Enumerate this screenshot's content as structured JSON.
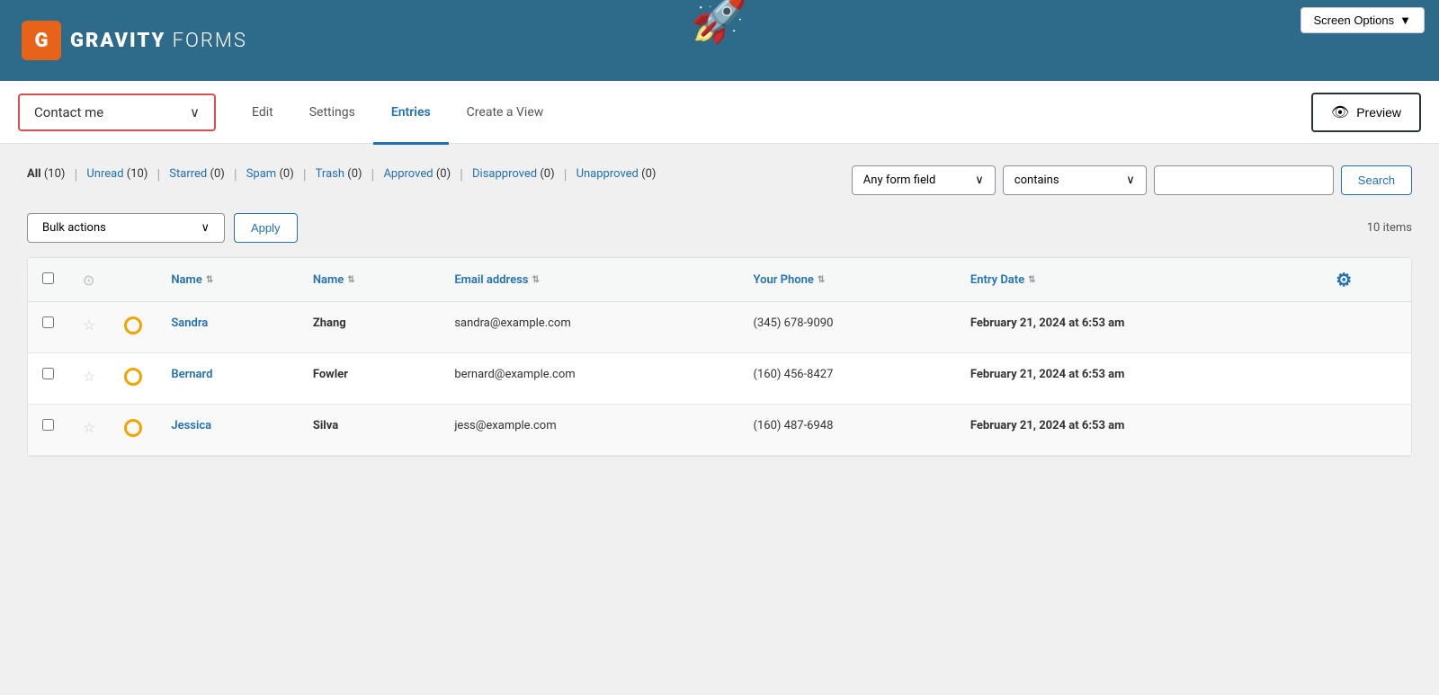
{
  "header": {
    "logo_letter": "G",
    "logo_bold": "GRAVITY",
    "logo_light": " FORMS",
    "screen_options_label": "Screen Options"
  },
  "nav": {
    "form_selector_label": "Contact me",
    "links": [
      {
        "id": "edit",
        "label": "Edit",
        "active": false
      },
      {
        "id": "settings",
        "label": "Settings",
        "active": false
      },
      {
        "id": "entries",
        "label": "Entries",
        "active": true
      },
      {
        "id": "create-view",
        "label": "Create a View",
        "active": false
      }
    ],
    "preview_label": "Preview"
  },
  "filters": {
    "all_label": "All",
    "all_count": "(10)",
    "unread_label": "Unread",
    "unread_count": "(10)",
    "starred_label": "Starred",
    "starred_count": "(0)",
    "spam_label": "Spam",
    "spam_count": "(0)",
    "trash_label": "Trash",
    "trash_count": "(0)",
    "approved_label": "Approved",
    "approved_count": "(0)",
    "disapproved_label": "Disapproved",
    "disapproved_count": "(0)",
    "unapproved_label": "Unapproved",
    "unapproved_count": "(0)"
  },
  "search": {
    "field_label": "Any form field",
    "condition_label": "contains",
    "input_placeholder": "",
    "search_button": "Search"
  },
  "bulk": {
    "actions_label": "Bulk actions",
    "apply_label": "Apply",
    "items_count": "10 items"
  },
  "table": {
    "columns": [
      {
        "id": "name-first",
        "label": "Name",
        "sortable": true
      },
      {
        "id": "name-last",
        "label": "Name",
        "sortable": true
      },
      {
        "id": "email",
        "label": "Email address",
        "sortable": true
      },
      {
        "id": "phone",
        "label": "Your Phone",
        "sortable": true
      },
      {
        "id": "date",
        "label": "Entry Date",
        "sortable": true
      }
    ],
    "rows": [
      {
        "id": "1",
        "first_name": "Sandra",
        "last_name": "Zhang",
        "email": "sandra@example.com",
        "phone": "(345) 678-9090",
        "date": "February 21, 2024 at 6:53 am"
      },
      {
        "id": "2",
        "first_name": "Bernard",
        "last_name": "Fowler",
        "email": "bernard@example.com",
        "phone": "(160) 456-8427",
        "date": "February 21, 2024 at 6:53 am"
      },
      {
        "id": "3",
        "first_name": "Jessica",
        "last_name": "Silva",
        "email": "jess@example.com",
        "phone": "(160) 487-6948",
        "date": "February 21, 2024 at 6:53 am"
      }
    ]
  },
  "colors": {
    "header_bg": "#2e6b8a",
    "logo_orange": "#e8631a",
    "accent_blue": "#2271b1",
    "border_red": "#d94f4f",
    "star_empty": "#ccc",
    "status_orange": "#f0a500"
  }
}
